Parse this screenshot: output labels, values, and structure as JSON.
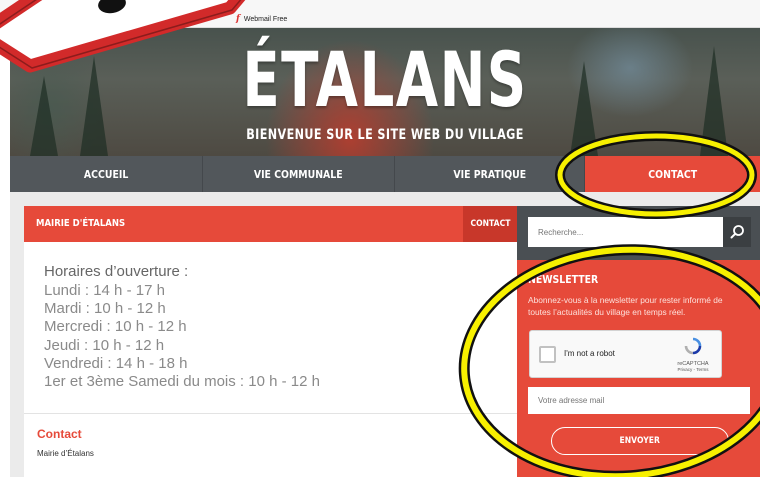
{
  "bookmarks": [
    {
      "icon": "free-f-icon",
      "label": "Webmail Free"
    }
  ],
  "header": {
    "title": "ÉTALANS",
    "subtitle": "BIENVENUE SUR LE SITE WEB DU VILLAGE"
  },
  "nav": {
    "items": [
      {
        "label": "ACCUEIL"
      },
      {
        "label": "VIE COMMUNALE"
      },
      {
        "label": "VIE PRATIQUE"
      },
      {
        "label": "CONTACT",
        "active": true
      }
    ]
  },
  "card": {
    "title": "MAIRIE D'ÉTALANS",
    "breadcrumb": "CONTACT",
    "hours_title": "Horaires d’ouverture :",
    "hours": [
      "Lundi : 14 h - 17 h",
      "Mardi : 10 h - 12 h",
      "Mercredi : 10 h - 12 h",
      "Jeudi : 10 h - 12 h",
      "Vendredi : 14 h - 18 h",
      "1er et 3ème Samedi du mois : 10 h - 12 h"
    ],
    "contact_title": "Contact",
    "contact_line": "Mairie d’Étalans"
  },
  "sidebar": {
    "search_placeholder": "Recherche...",
    "newsletter": {
      "title": "NEWSLETTER",
      "text": "Abonnez-vous à la newsletter pour rester informé de toutes l’actualités du village en temps réel.",
      "captcha_label": "I'm not a robot",
      "captcha_brand": "reCAPTCHA",
      "captcha_links": "Privacy - Terms",
      "email_placeholder": "Votre adresse mail",
      "submit_label": "ENVOYER"
    }
  },
  "colors": {
    "accent": "#e64a3a",
    "accent_dark": "#c8372a",
    "nav_bg": "#52575b",
    "sidebar_bg": "#4a4f53",
    "annotation": "#f7f000"
  }
}
